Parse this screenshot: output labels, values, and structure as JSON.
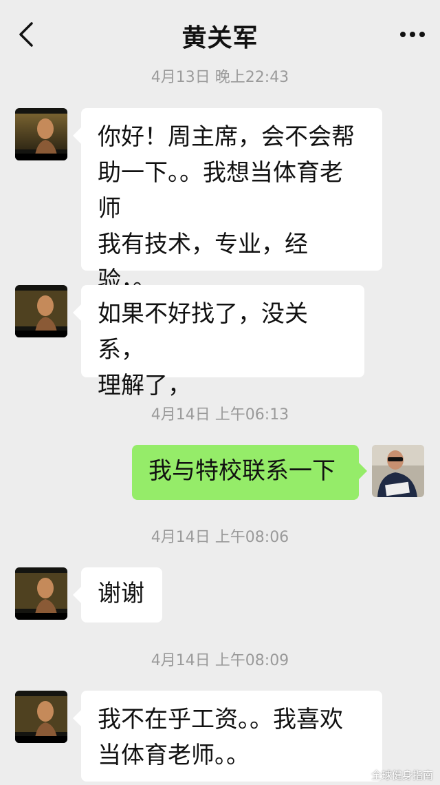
{
  "header": {
    "title": "黄关军"
  },
  "messages": {
    "ts1": "4月13日 晚上22:43",
    "m1": "你好！周主席，会不会帮\n助一下。。我想当体育老\n师\n我有技术，专业，经验，。",
    "m2": "如果不好找了，没关系，\n理解了，",
    "ts2": "4月14日 上午06:13",
    "m3": "我与特校联系一下",
    "ts3": "4月14日 上午08:06",
    "m4": "谢谢",
    "ts4": "4月14日 上午08:09",
    "m5": "我不在乎工资。。我喜欢\n当体育老师。。"
  },
  "watermark": "全球健身指南",
  "colors": {
    "background": "#ededed",
    "incoming_bubble": "#ffffff",
    "outgoing_bubble": "#95ec69",
    "timestamp": "#9a9a9a"
  },
  "icons": {
    "back": "chevron-left-icon",
    "more": "more-dots-icon"
  }
}
